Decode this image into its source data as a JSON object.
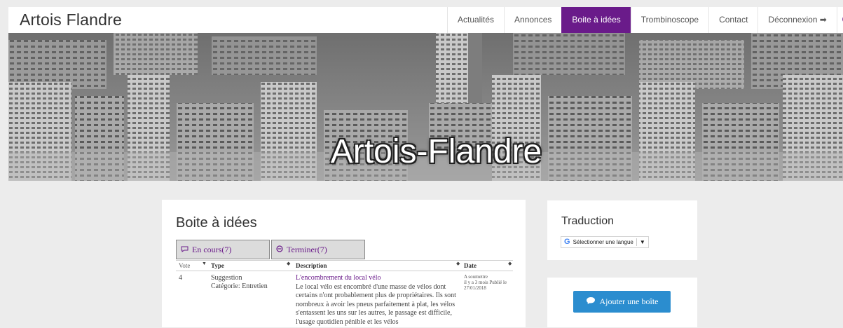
{
  "header": {
    "site_title": "Artois Flandre",
    "nav": [
      {
        "label": "Actualités"
      },
      {
        "label": "Annonces"
      },
      {
        "label": "Boite à idées",
        "active": true
      },
      {
        "label": "Trombinoscope"
      },
      {
        "label": "Contact"
      },
      {
        "label": "Déconnexion ➡"
      }
    ],
    "search_icon": "search-icon"
  },
  "hero": {
    "title": "Artois-Flandre"
  },
  "main": {
    "title": "Boite à idées",
    "tabs": [
      {
        "label": "En cours(7)",
        "icon": "comments-icon"
      },
      {
        "label": "Terminer(7)",
        "icon": "check-circle-icon"
      }
    ],
    "table": {
      "headers": [
        "Vote",
        "Type",
        "Description",
        "Date"
      ],
      "rows": [
        {
          "vote": "4",
          "type": "Suggestion",
          "category": "Catégorie: Entretien",
          "title": "L'encombrement du local vélo",
          "description": "Le local vélo est encombré d'une masse de vélos dont certains n'ont probablement plus de propriétaires. Ils sont nombreux à avoir les pneus parfaitement à plat, les vélos s'entassent les uns sur les autres, le passage est difficile, l'usage quotidien pénible et les vélos",
          "status": "A soumettre",
          "date": "il y a 3 mois Publié le 27/01/2018"
        }
      ]
    }
  },
  "sidebar": {
    "translation_title": "Traduction",
    "translate_select": "Sélectionner une langue",
    "add_button": "Ajouter une boîte"
  },
  "colors": {
    "accent": "#6a1b8a",
    "button": "#2b8dcf"
  }
}
